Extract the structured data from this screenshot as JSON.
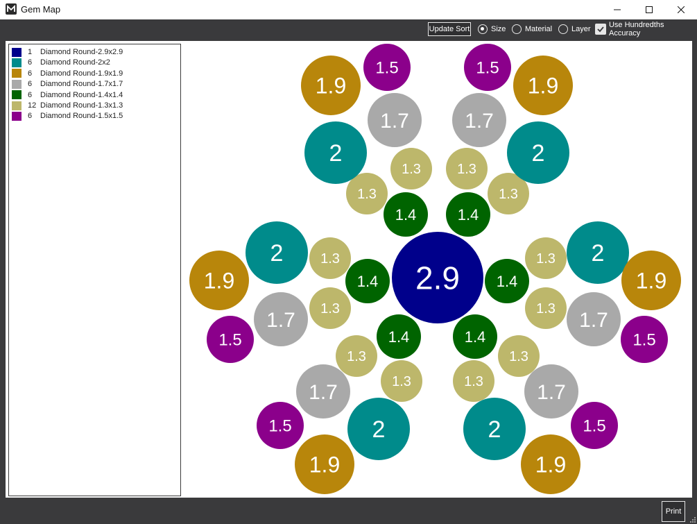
{
  "window": {
    "title": "Gem Map",
    "icon": "logo-icon"
  },
  "toolbar": {
    "update_sort_label": "Update Sort",
    "sort_options": [
      {
        "label": "Size",
        "selected": true
      },
      {
        "label": "Material",
        "selected": false
      },
      {
        "label": "Layer",
        "selected": false
      }
    ],
    "hundredths_label": "Use Hundredths Accuracy",
    "hundredths_checked": true
  },
  "legend": [
    {
      "count": "1",
      "name": "Diamond Round-2.9x2.9",
      "color": "#00008b"
    },
    {
      "count": "6",
      "name": "Diamond Round-2x2",
      "color": "#008b8b"
    },
    {
      "count": "6",
      "name": "Diamond Round-1.9x1.9",
      "color": "#b8860b"
    },
    {
      "count": "6",
      "name": "Diamond Round-1.7x1.7",
      "color": "#a9a9a9"
    },
    {
      "count": "6",
      "name": "Diamond Round-1.4x1.4",
      "color": "#006400"
    },
    {
      "count": "12",
      "name": "Diamond Round-1.3x1.3",
      "color": "#bdb76b"
    },
    {
      "count": "6",
      "name": "Diamond Round-1.5x1.5",
      "color": "#8b008b"
    }
  ],
  "gems": [
    {
      "label": "2.9",
      "color": "#00008b"
    },
    {
      "label": "1.4",
      "color": "#006400"
    },
    {
      "label": "1.4",
      "color": "#006400"
    },
    {
      "label": "1.4",
      "color": "#006400"
    },
    {
      "label": "1.4",
      "color": "#006400"
    },
    {
      "label": "1.4",
      "color": "#006400"
    },
    {
      "label": "1.4",
      "color": "#006400"
    },
    {
      "label": "1.3",
      "color": "#bdb76b"
    },
    {
      "label": "1.3",
      "color": "#bdb76b"
    },
    {
      "label": "1.3",
      "color": "#bdb76b"
    },
    {
      "label": "1.3",
      "color": "#bdb76b"
    },
    {
      "label": "1.3",
      "color": "#bdb76b"
    },
    {
      "label": "1.3",
      "color": "#bdb76b"
    },
    {
      "label": "1.3",
      "color": "#bdb76b"
    },
    {
      "label": "1.3",
      "color": "#bdb76b"
    },
    {
      "label": "1.3",
      "color": "#bdb76b"
    },
    {
      "label": "1.3",
      "color": "#bdb76b"
    },
    {
      "label": "1.3",
      "color": "#bdb76b"
    },
    {
      "label": "1.3",
      "color": "#bdb76b"
    },
    {
      "label": "2",
      "color": "#008b8b"
    },
    {
      "label": "2",
      "color": "#008b8b"
    },
    {
      "label": "2",
      "color": "#008b8b"
    },
    {
      "label": "2",
      "color": "#008b8b"
    },
    {
      "label": "2",
      "color": "#008b8b"
    },
    {
      "label": "2",
      "color": "#008b8b"
    },
    {
      "label": "1.7",
      "color": "#a9a9a9"
    },
    {
      "label": "1.7",
      "color": "#a9a9a9"
    },
    {
      "label": "1.7",
      "color": "#a9a9a9"
    },
    {
      "label": "1.7",
      "color": "#a9a9a9"
    },
    {
      "label": "1.7",
      "color": "#a9a9a9"
    },
    {
      "label": "1.7",
      "color": "#a9a9a9"
    },
    {
      "label": "1.9",
      "color": "#b8860b"
    },
    {
      "label": "1.9",
      "color": "#b8860b"
    },
    {
      "label": "1.9",
      "color": "#b8860b"
    },
    {
      "label": "1.9",
      "color": "#b8860b"
    },
    {
      "label": "1.9",
      "color": "#b8860b"
    },
    {
      "label": "1.9",
      "color": "#b8860b"
    },
    {
      "label": "1.5",
      "color": "#8b008b"
    },
    {
      "label": "1.5",
      "color": "#8b008b"
    },
    {
      "label": "1.5",
      "color": "#8b008b"
    },
    {
      "label": "1.5",
      "color": "#8b008b"
    },
    {
      "label": "1.5",
      "color": "#8b008b"
    },
    {
      "label": "1.5",
      "color": "#8b008b"
    }
  ],
  "footer": {
    "print_label": "Print"
  }
}
